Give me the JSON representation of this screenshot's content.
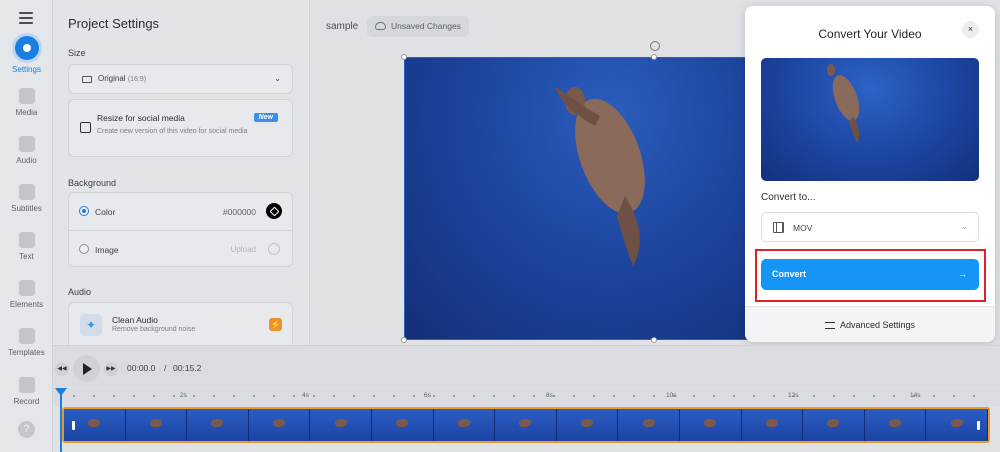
{
  "rail": {
    "items": [
      {
        "label": "Settings",
        "icon": "settings-icon",
        "active": true
      },
      {
        "label": "Media",
        "icon": "plus-icon"
      },
      {
        "label": "Audio",
        "icon": "music-note-icon"
      },
      {
        "label": "Subtitles",
        "icon": "subtitles-icon"
      },
      {
        "label": "Text",
        "icon": "text-icon"
      },
      {
        "label": "Elements",
        "icon": "elements-icon"
      },
      {
        "label": "Templates",
        "icon": "templates-icon"
      },
      {
        "label": "Record",
        "icon": "record-icon"
      }
    ],
    "help": "?"
  },
  "panel": {
    "title": "Project Settings",
    "size_label": "Size",
    "size_value": "Original",
    "size_ratio": "(16:9)",
    "resize_title": "Resize for social media",
    "resize_desc": "Create new version of this video for social media",
    "resize_badge": "New",
    "background_label": "Background",
    "color_label": "Color",
    "color_value": "#000000",
    "image_label": "Image",
    "upload_label": "Upload",
    "audio_label": "Audio",
    "clean_audio_title": "Clean Audio",
    "clean_audio_desc": "Remove background noise"
  },
  "topbar": {
    "project_name": "sample",
    "status": "Unsaved Changes"
  },
  "modal": {
    "title": "Convert Your Video",
    "close": "×",
    "convert_to_label": "Convert to...",
    "format": "MOV",
    "convert_button": "Convert",
    "convert_arrow": "→",
    "advanced": "Advanced Settings"
  },
  "player": {
    "current_time": "00:00.0",
    "separator": "/",
    "total_time": "00:15.2"
  },
  "timeline": {
    "ticks": [
      "2s",
      "4s",
      "6s",
      "8s",
      "10s",
      "12s",
      "14s"
    ],
    "thumbnail_count": 15
  },
  "colors": {
    "accent": "#1a7fe0",
    "convert_button": "#1595f5",
    "highlight": "#e01f26",
    "track_border": "#e89a2f"
  }
}
